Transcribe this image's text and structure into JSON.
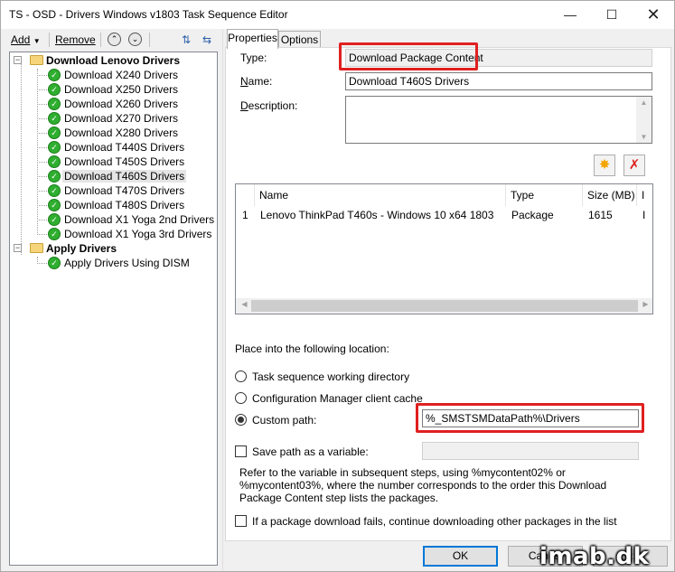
{
  "window": {
    "title": "TS - OSD - Drivers Windows v1803 Task Sequence Editor",
    "min": "—",
    "max": "☐",
    "close": "✕"
  },
  "toolbar": {
    "add": "Add",
    "remove": "Remove"
  },
  "tree": {
    "groups": [
      {
        "label": "Download Lenovo Drivers",
        "items": [
          "Download X240 Drivers",
          "Download X250 Drivers",
          "Download X260 Drivers",
          "Download X270 Drivers",
          "Download X280 Drivers",
          "Download T440S Drivers",
          "Download T450S Drivers",
          "Download T460S Drivers",
          "Download T470S Drivers",
          "Download T480S Drivers",
          "Download X1 Yoga 2nd Drivers",
          "Download X1 Yoga 3rd Drivers"
        ]
      },
      {
        "label": "Apply Drivers",
        "items": [
          "Apply Drivers Using DISM"
        ]
      }
    ],
    "selected": "Download T460S Drivers"
  },
  "tabs": {
    "properties": "Properties",
    "options": "Options"
  },
  "form": {
    "type_label": "Type:",
    "type_value": "Download Package Content",
    "name_label": "Name:",
    "name_value": "Download T460S Drivers",
    "description_label": "Description:",
    "description_value": ""
  },
  "packages": {
    "columns": [
      "Name",
      "Type",
      "Size (MB)",
      "I"
    ],
    "rows": [
      {
        "index": "1",
        "name": "Lenovo ThinkPad T460s - Windows 10 x64 1803",
        "type": "Package",
        "size": "1615",
        "extra": "I"
      }
    ]
  },
  "location": {
    "heading": "Place into the following location:",
    "opt_working_dir": "Task sequence working directory",
    "opt_client_cache": "Configuration Manager client cache",
    "opt_custom": "Custom path:",
    "custom_path_value": "%_SMSTSMDataPath%\\Drivers",
    "selected": "custom"
  },
  "save_var": {
    "label": "Save path as a variable:",
    "value": "",
    "checked": false,
    "help": "Refer to the variable in subsequent steps, using %mycontent02% or %mycontent03%, where the number corresponds to the order this Download Package Content step lists the packages."
  },
  "continue": {
    "label": "If a package download fails, continue downloading other packages in the list",
    "checked": false
  },
  "buttons": {
    "ok": "OK",
    "cancel": "Cancel",
    "apply": "Apply"
  },
  "watermark": "imab.dk",
  "colors": {
    "highlight": "#e02020",
    "focus": "#0078d7",
    "check": "#2fae2f"
  }
}
